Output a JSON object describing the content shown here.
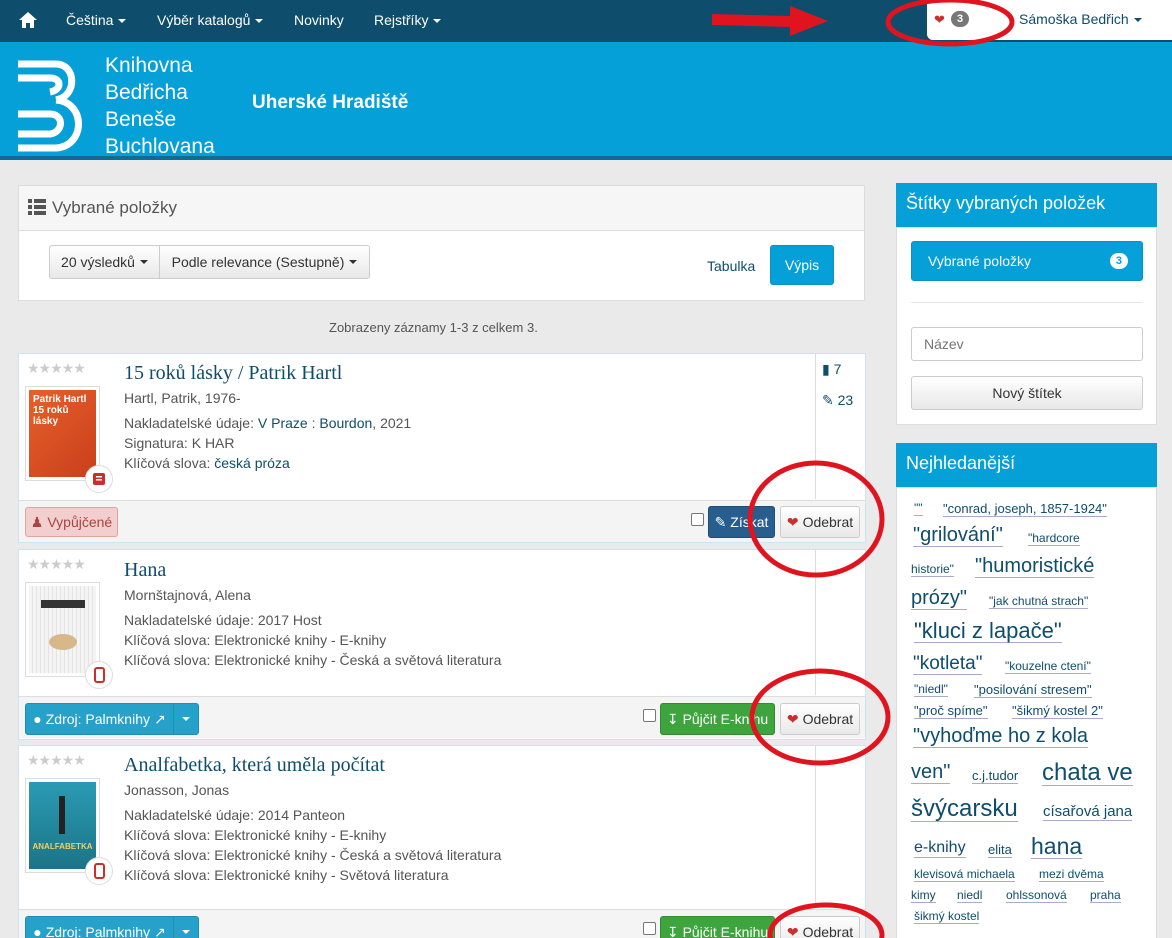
{
  "navbar": {
    "items": [
      {
        "label": "Čeština",
        "has_caret": true
      },
      {
        "label": "Výběr katalogů",
        "has_caret": true
      },
      {
        "label": "Novinky",
        "has_caret": false
      },
      {
        "label": "Rejstříky",
        "has_caret": true
      }
    ],
    "favorites_count": "3",
    "user_label": "Sámoška Bedřich"
  },
  "header": {
    "logo_lines": [
      "Knihovna",
      "Bedřicha",
      "Beneše",
      "Buchlovana"
    ],
    "city": "Uherské Hradiště"
  },
  "main": {
    "title": "Vybrané položky",
    "results_dropdown": "20 výsledků",
    "sort_dropdown": "Podle relevance (Sestupně)",
    "view_table": "Tabulka",
    "view_list": "Výpis",
    "summary": "Zobrazeny záznamy 1-3 z celkem 3."
  },
  "records": [
    {
      "title": "15 roků lásky / Patrik Hartl",
      "author": "Hartl, Patrik, 1976-",
      "publisher_label": "Nakladatelské údaje:",
      "publisher_link1": "V Praze",
      "publisher_sep": " : ",
      "publisher_link2": "Bourdon",
      "publisher_rest": ", 2021",
      "signature_label": "Signatura:",
      "signature": "K HAR",
      "keywords_label": "Klíčová slova:",
      "keywords_link": "česká próza",
      "stat1": "7",
      "stat2": "23",
      "status_button": "Vypůjčené",
      "get_button": "Získat",
      "remove_button": "Odebrat",
      "cover_text": "Patrik Hartl 15 roků lásky"
    },
    {
      "title": "Hana",
      "author": "Mornštajnová, Alena",
      "lines": [
        "Nakladatelské údaje: 2017 Host",
        "Klíčová slova: Elektronické knihy - E-knihy",
        "Klíčová slova: Elektronické knihy - Česká a světová literatura"
      ],
      "source_button": "Zdroj: Palmknihy",
      "borrow_button": "Půjčit E-knihu",
      "remove_button": "Odebrat"
    },
    {
      "title": "Analfabetka, která uměla počítat",
      "author": "Jonasson, Jonas",
      "lines": [
        "Nakladatelské údaje: 2014 Panteon",
        "Klíčová slova: Elektronické knihy - E-knihy",
        "Klíčová slova: Elektronické knihy - Česká a světová literatura",
        "Klíčová slova: Elektronické knihy - Světová literatura"
      ],
      "source_button": "Zdroj: Palmknihy",
      "borrow_button": "Půjčit E-knihu",
      "remove_button": "Odebrat",
      "cover_text": "ANALFABETKA"
    }
  ],
  "sidebar": {
    "tags_title": "Štítky vybraných položek",
    "selected_label": "Vybrané položky",
    "selected_count": "3",
    "name_placeholder": "Název",
    "new_tag_button": "Nový štítek",
    "popular_title": "Nejhledanější",
    "popular_tags": [
      "\"\"",
      "\"conrad, joseph, 1857-1924\"",
      "\"grilování\"",
      "\"hardcore",
      "historie\"",
      "\"humoristické",
      "prózy\"",
      "\"jak chutná strach\"",
      "\"kluci z lapače\"",
      "\"kotleta\"",
      "\"kouzelne ctení\"",
      "\"niedl\"",
      "\"posilování stresem\"",
      "\"proč spíme\"",
      "\"šikmý kostel 2\"",
      "\"vyhoďme ho z kola",
      "ven\"",
      "c.j.tudor",
      "chata ve",
      "švýcarsku",
      "císařová jana",
      "e-knihy",
      "elita",
      "hana",
      "klevisová michaela",
      "mezi dvěma",
      "kimy",
      "niedl",
      "ohlssonová",
      "praha",
      "šikmý kostel"
    ]
  },
  "colors": {
    "navbar": "#0e4d6b",
    "header": "#06a0d9",
    "link": "#0e4d6b",
    "annotation": "#e0141e"
  }
}
